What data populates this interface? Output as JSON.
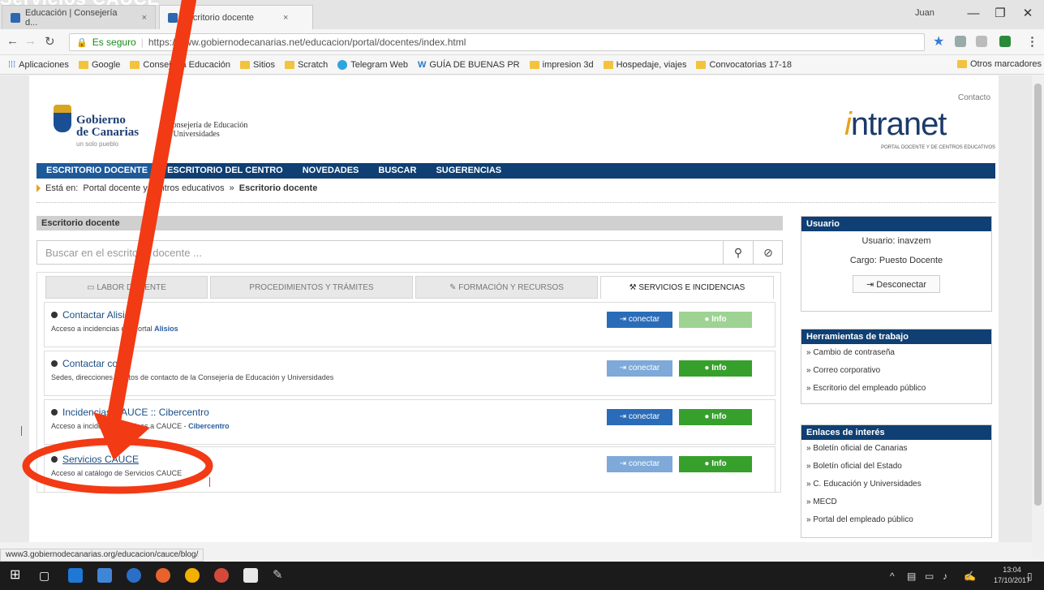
{
  "browser": {
    "tabs": [
      {
        "label": "Educación | Consejería d..."
      },
      {
        "label": "Escritorio docente"
      }
    ],
    "user": "Juan",
    "min": "—",
    "max": "❐",
    "close": "✕",
    "secure_label": "Es seguro",
    "url": "https://www.gobiernodecanarias.net/educacion/portal/docentes/index.html",
    "bookmarks": [
      "Aplicaciones",
      "Google",
      "Consejería Educación",
      "Sitios",
      "Scratch",
      "Telegram Web",
      "GUÍA DE BUENAS PR",
      "impresion 3d",
      "Hospedaje, viajes",
      "Convocatorias 17-18"
    ],
    "other_bookmarks": "Otros marcadores",
    "status_url": "www3.gobiernodecanarias.org/educacion/cauce/blog/"
  },
  "header": {
    "org_name_1": "Gobierno",
    "org_name_2": "de Canarias",
    "org_tag": "un solo pueblo",
    "consejeria": "Consejería de Educación\ny Universidades",
    "contacto": "Contacto",
    "intranet_i": "i",
    "intranet_rest": "ntranet",
    "intranet_sub": "PORTAL DOCENTE Y DE CENTROS EDUCATIVOS"
  },
  "nav": [
    "ESCRITORIO DOCENTE",
    "ESCRITORIO DEL CENTRO",
    "NOVEDADES",
    "BUSCAR",
    "SUGERENCIAS"
  ],
  "breadcrumb": {
    "prefix": "Está en:",
    "path": "Portal docente y centros educativos",
    "sep": "»",
    "current": "Escritorio docente"
  },
  "escritorio": {
    "title": "Escritorio docente",
    "search_placeholder": "Buscar en el escritorio docente ...",
    "search_icon": "⚲",
    "clear_icon": "⊘",
    "tabs": [
      {
        "label": "LABOR DOCENTE",
        "icon": "▭"
      },
      {
        "label": "PROCEDIMIENTOS Y TRÁMITES",
        "icon": ""
      },
      {
        "label": "FORMACIÓN Y RECURSOS",
        "icon": "✎"
      },
      {
        "label": "SERVICIOS E INCIDENCIAS",
        "icon": "⚒"
      }
    ],
    "services": [
      {
        "title": "Contactar Alisios",
        "desc": "Acceso a incidencias del Portal ",
        "desc_em": "Alisios",
        "connect": "⇥ conectar",
        "info": "● Info",
        "light": true
      },
      {
        "title": "Contactar con...",
        "desc": "Sedes, direcciones y datos de contacto de la Consejería de Educación y Universidades",
        "desc_em": "",
        "connect": "⇥ conectar",
        "info": "● Info",
        "light": false
      },
      {
        "title": "Incidencias CAUCE :: Cibercentro",
        "desc": "Acceso a incidencias técnicas a CAUCE - ",
        "desc_em": "Cibercentro",
        "connect": "⇥ conectar",
        "info": "● Info",
        "light": false
      },
      {
        "title": "Servicios CAUCE",
        "desc": "Acceso al catálogo de Servicios CAUCE",
        "desc_em": "",
        "connect": "⇥ conectar",
        "info": "● Info",
        "light": false
      }
    ]
  },
  "sidebar": {
    "usuario_title": "Usuario",
    "usuario_line": "Usuario: inavzem",
    "cargo_line": "Cargo: Puesto Docente",
    "logout": "⇥ Desconectar",
    "tools_title": "Herramientas de trabajo",
    "tools": [
      "» Cambio de contraseña",
      "» Correo corporativo",
      "» Escritorio del empleado público"
    ],
    "links_title": "Enlaces de interés",
    "links": [
      "» Boletín oficial de Canarias",
      "» Boletín oficial del Estado",
      "» C. Educación y Universidades",
      "» MECD",
      "» Portal del empleado público"
    ]
  },
  "taskbar": {
    "time": "13:04",
    "date": "17/10/2017"
  },
  "annotation": {
    "title": "Servicios CAUCE",
    "color": "#f23a14"
  }
}
